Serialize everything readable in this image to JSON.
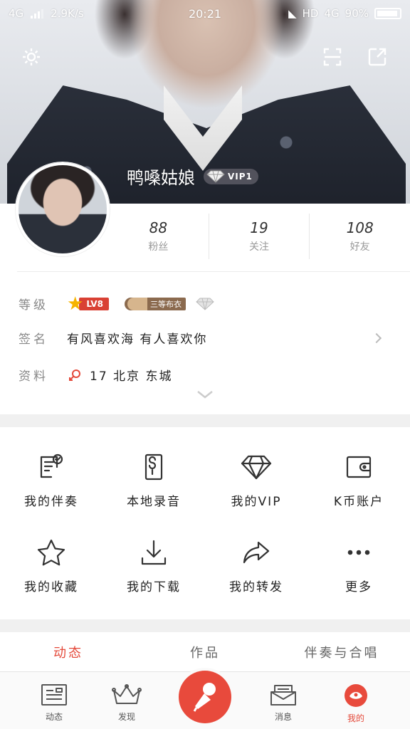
{
  "status_bar": {
    "network": "4G",
    "speed": "2.9K/s",
    "time": "20:21",
    "hd": "HD",
    "network_right": "4G",
    "battery": "90%"
  },
  "profile": {
    "nickname": "鸭嗓姑娘",
    "vip_label": "VIP1",
    "stats": [
      {
        "value": "88",
        "label": "粉丝"
      },
      {
        "value": "19",
        "label": "关注"
      },
      {
        "value": "108",
        "label": "好友"
      }
    ],
    "level_key": "等级",
    "level_tag": "LV8",
    "rank_label": "三等布衣",
    "sign_key": "签名",
    "sign_value": "有风喜欢海 有人喜欢你",
    "info_key": "资料",
    "info_value": "17 北京 东城"
  },
  "grid": {
    "items": [
      {
        "label": "我的伴奏",
        "icon": "accompaniment-icon"
      },
      {
        "label": "本地录音",
        "icon": "local-recording-icon"
      },
      {
        "label": "我的VIP",
        "icon": "vip-diamond-icon"
      },
      {
        "label": "K币账户",
        "icon": "wallet-icon"
      },
      {
        "label": "我的收藏",
        "icon": "star-icon"
      },
      {
        "label": "我的下载",
        "icon": "download-icon"
      },
      {
        "label": "我的转发",
        "icon": "share-icon"
      },
      {
        "label": "更多",
        "icon": "more-icon"
      }
    ]
  },
  "tabs": {
    "items": [
      {
        "label": "动态"
      },
      {
        "label": "作品"
      },
      {
        "label": "伴奏与合唱"
      }
    ]
  },
  "bottom_nav": {
    "items": [
      {
        "label": "动态",
        "icon": "feed-icon"
      },
      {
        "label": "发现",
        "icon": "crown-icon"
      },
      {
        "label": "消息",
        "icon": "message-icon"
      },
      {
        "label": "我的",
        "icon": "me-icon"
      }
    ]
  },
  "colors": {
    "accent": "#e4493a",
    "level_tag": "#d94134",
    "level_star": "#f6b400"
  }
}
